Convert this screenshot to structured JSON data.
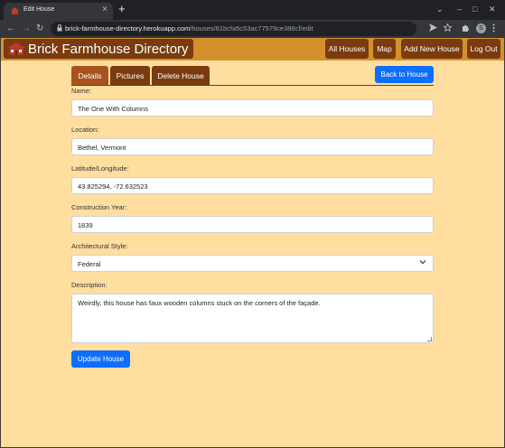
{
  "browser": {
    "tab_title": "Edit House",
    "tab_close": "×",
    "new_tab": "+",
    "url_host": "brick-farmhouse-directory.herokuapp.com",
    "url_path": "/houses/61bcfa5c53ac77579ce388cf/edit",
    "profile_initial": "S",
    "controls": {
      "chevron": "⌄",
      "minimize": "–",
      "maximize": "□",
      "close": "✕"
    },
    "nav": {
      "back": "←",
      "forward": "→",
      "reload": "↻"
    },
    "icons": {
      "lock": "lock-icon",
      "share": "send-icon",
      "bookmark": "star-icon",
      "extensions": "puzzle-icon",
      "menu": "kebab-menu-icon"
    }
  },
  "navbar": {
    "brand": "Brick Farmhouse Directory",
    "links": [
      "All Houses",
      "Map",
      "Add New House",
      "Log Out"
    ]
  },
  "tabs": [
    "Details",
    "Pictures",
    "Delete House"
  ],
  "back_button": "Back to House",
  "form": {
    "name": {
      "label": "Name:",
      "value": "The One With Columns"
    },
    "location": {
      "label": "Location:",
      "value": "Bethel, Vermont"
    },
    "latlng": {
      "label": "Latitude/Longitude:",
      "value": "43.825294, -72.632523"
    },
    "year": {
      "label": "Construction Year:",
      "value": "1839"
    },
    "style": {
      "label": "Architectural Style:",
      "value": "Federal"
    },
    "description": {
      "label": "Description:",
      "value": "Weirdly, this house has faux wooden columns stuck on the corners of the façade."
    },
    "submit": "Update House"
  },
  "colors": {
    "page_bg": "#ffdea0",
    "navbar_bg": "#d4912b",
    "button_brown": "#7a3b0e",
    "primary": "#0d6efd"
  }
}
